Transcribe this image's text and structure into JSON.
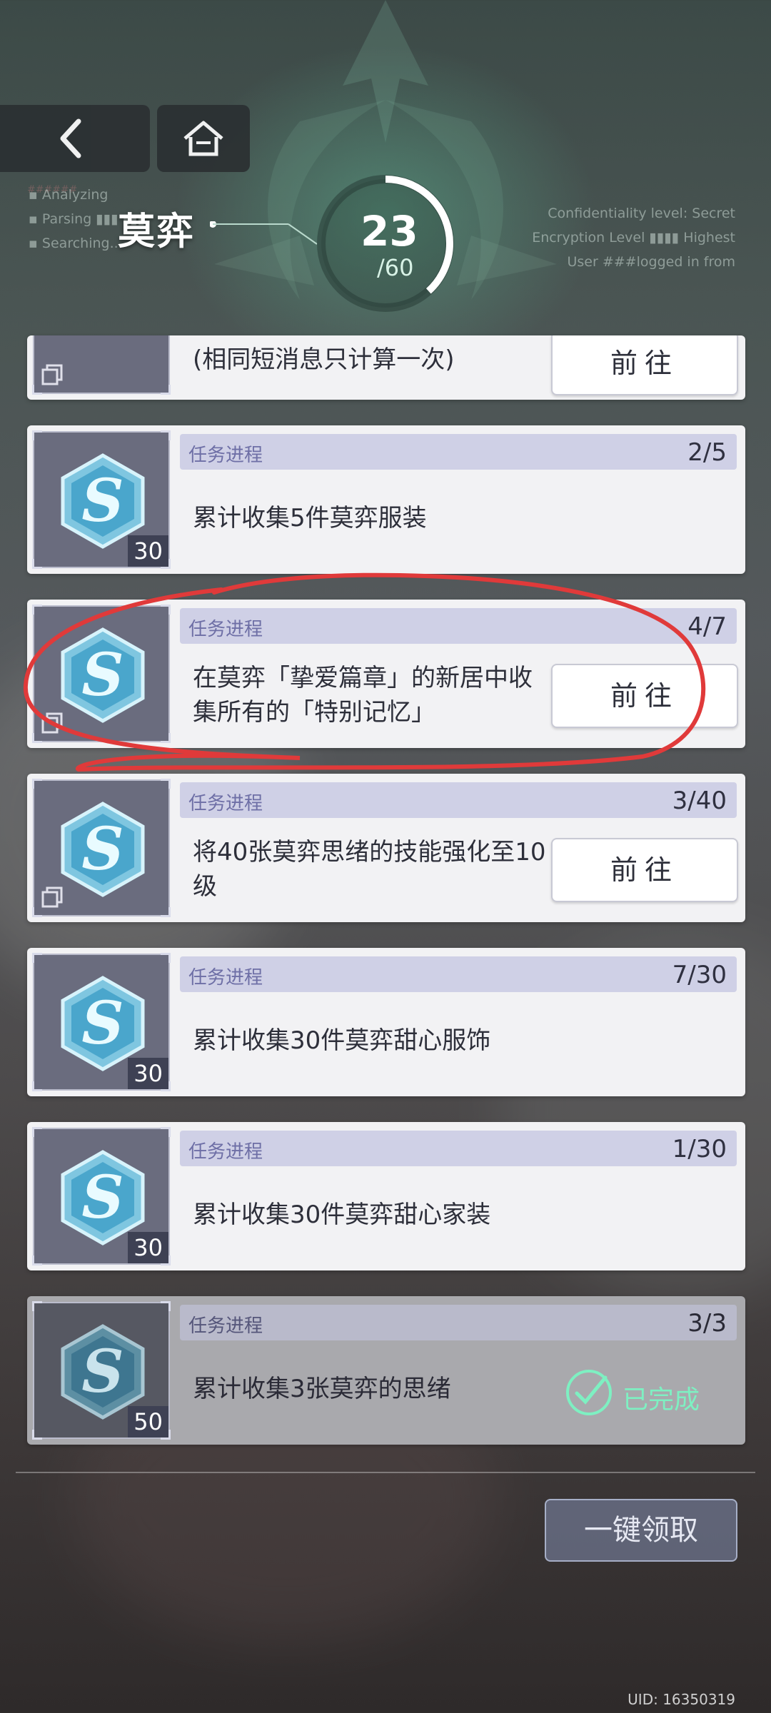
{
  "header": {
    "character_name": "莫弈",
    "progress_current": "23",
    "progress_total": "/60",
    "progress_fraction": 0.383,
    "system_text_left": [
      "Analyzing",
      "Parsing ▮▮▮ ▮▮▮",
      "Searching..."
    ],
    "system_text_right": [
      "Confidentiality level: Secret",
      "Encryption Level ▮▮▮▮ Highest",
      "User ###logged in from"
    ]
  },
  "tasks": [
    {
      "description": "(相同短消息只计算一次)",
      "button": "前往"
    },
    {
      "progress_label": "任务进程",
      "progress": "2/5",
      "description": "累计收集5件莫弈服装",
      "reward_count": "30"
    },
    {
      "progress_label": "任务进程",
      "progress": "4/7",
      "description": "在莫弈「挚爱篇章」的新居中收集所有的「特别记忆」",
      "button": "前往"
    },
    {
      "progress_label": "任务进程",
      "progress": "3/40",
      "description": "将40张莫弈思绪的技能强化至10级",
      "button": "前往"
    },
    {
      "progress_label": "任务进程",
      "progress": "7/30",
      "description": "累计收集30件莫弈甜心服饰",
      "reward_count": "30"
    },
    {
      "progress_label": "任务进程",
      "progress": "1/30",
      "description": "累计收集30件莫弈甜心家装",
      "reward_count": "30"
    },
    {
      "progress_label": "任务进程",
      "progress": "3/3",
      "description": "累计收集3张莫弈的思绪",
      "reward_count": "50",
      "status": "已完成"
    }
  ],
  "footer": {
    "claim_all_label": "一键领取",
    "uid": "UID: 16350319"
  },
  "colors": {
    "accent_teal": "#7ef0c2",
    "progress_bar": "#cfd0e6",
    "annotation_red": "#e03a3a"
  },
  "icons": [
    "back-icon",
    "home-icon",
    "crystal-s-icon",
    "duplicate-icon",
    "check-circle-icon"
  ]
}
